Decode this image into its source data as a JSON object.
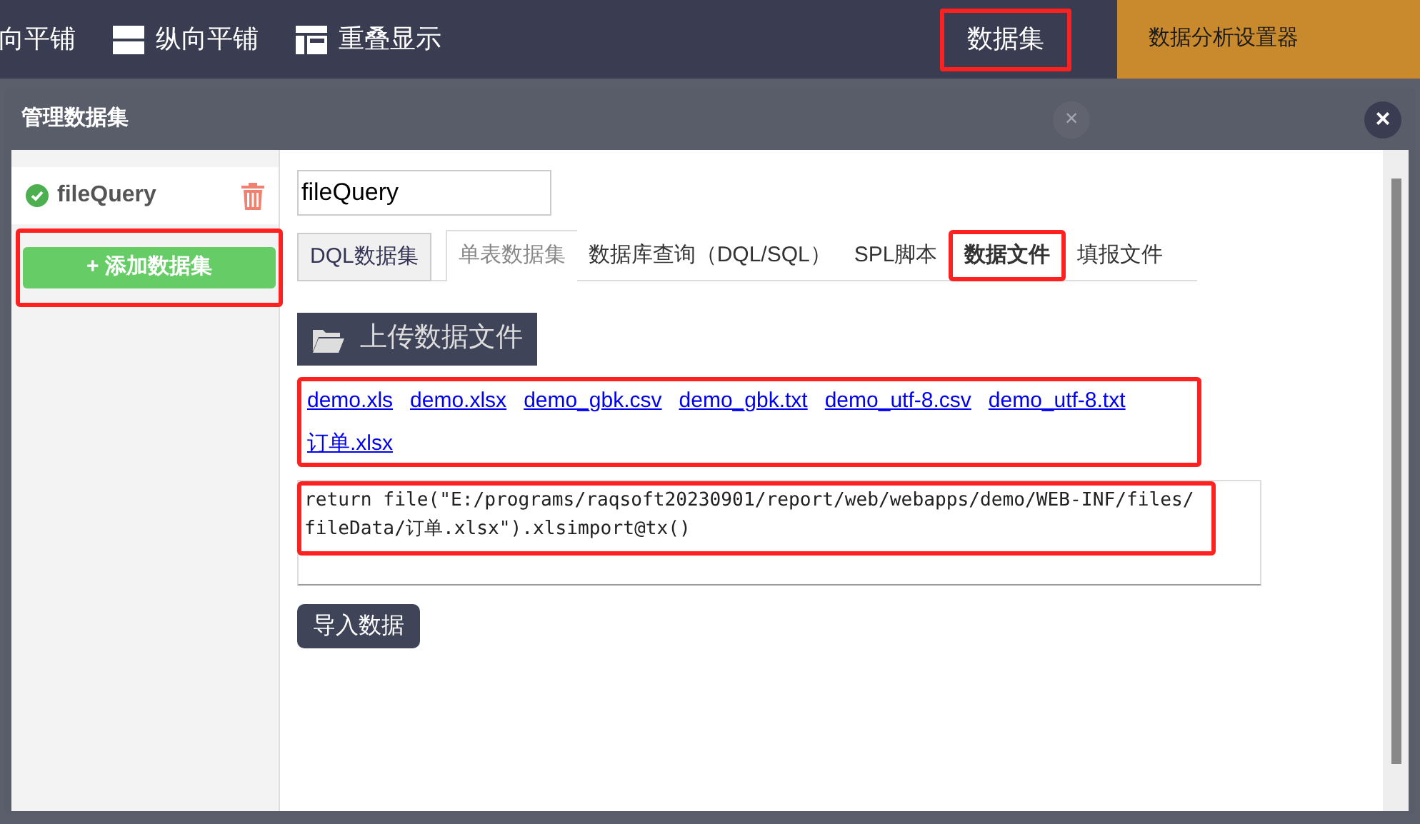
{
  "toolbar": {
    "items": [
      {
        "label": "向平铺",
        "kind": "plain"
      },
      {
        "label": "纵向平铺",
        "kind": "vertical"
      },
      {
        "label": "重叠显示",
        "kind": "overlap"
      }
    ],
    "dataset_button": "数据集",
    "settings_tab": "数据分析设置器"
  },
  "background_dialog": {
    "close": "×"
  },
  "dialog": {
    "title": "管理数据集",
    "close": "×",
    "sidebar": {
      "datasets": [
        {
          "name": "fileQuery",
          "valid": true
        }
      ],
      "add_button": "+ 添加数据集"
    },
    "name_field": {
      "value": "fileQuery"
    },
    "tabs": [
      {
        "label": "DQL数据集",
        "selected": false,
        "disabled": false
      },
      {
        "label": "单表数据集",
        "selected": false,
        "disabled": true
      },
      {
        "label": "数据库查询（DQL/SQL）",
        "selected": false,
        "disabled": false
      },
      {
        "label": "SPL脚本",
        "selected": false,
        "disabled": false
      },
      {
        "label": "数据文件",
        "selected": true,
        "disabled": false
      },
      {
        "label": "填报文件",
        "selected": false,
        "disabled": false
      }
    ],
    "upload_button": "上传数据文件",
    "files": [
      "demo.xls",
      "demo.xlsx",
      "demo_gbk.csv",
      "demo_gbk.txt",
      "demo_utf-8.csv",
      "demo_utf-8.txt",
      "订单.xlsx"
    ],
    "script": "return file(\"E:/programs/raqsoft20230901/report/web/webapps/demo/WEB-INF/files/fileData/订单.xlsx\").xlsimport@tx()",
    "import_button": "导入数据"
  }
}
